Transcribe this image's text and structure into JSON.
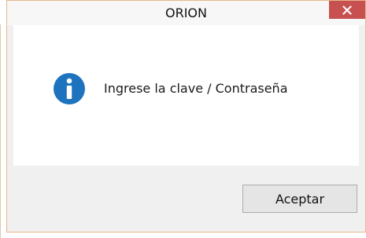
{
  "window": {
    "title": "ORION",
    "close_glyph": "×",
    "close_icon": "close-icon",
    "accent_color": "#c75050"
  },
  "message": {
    "icon": "info-icon",
    "icon_color": "#1e73be",
    "text": "Ingrese la clave / Contraseña"
  },
  "buttons": {
    "ok_label": "Aceptar"
  }
}
